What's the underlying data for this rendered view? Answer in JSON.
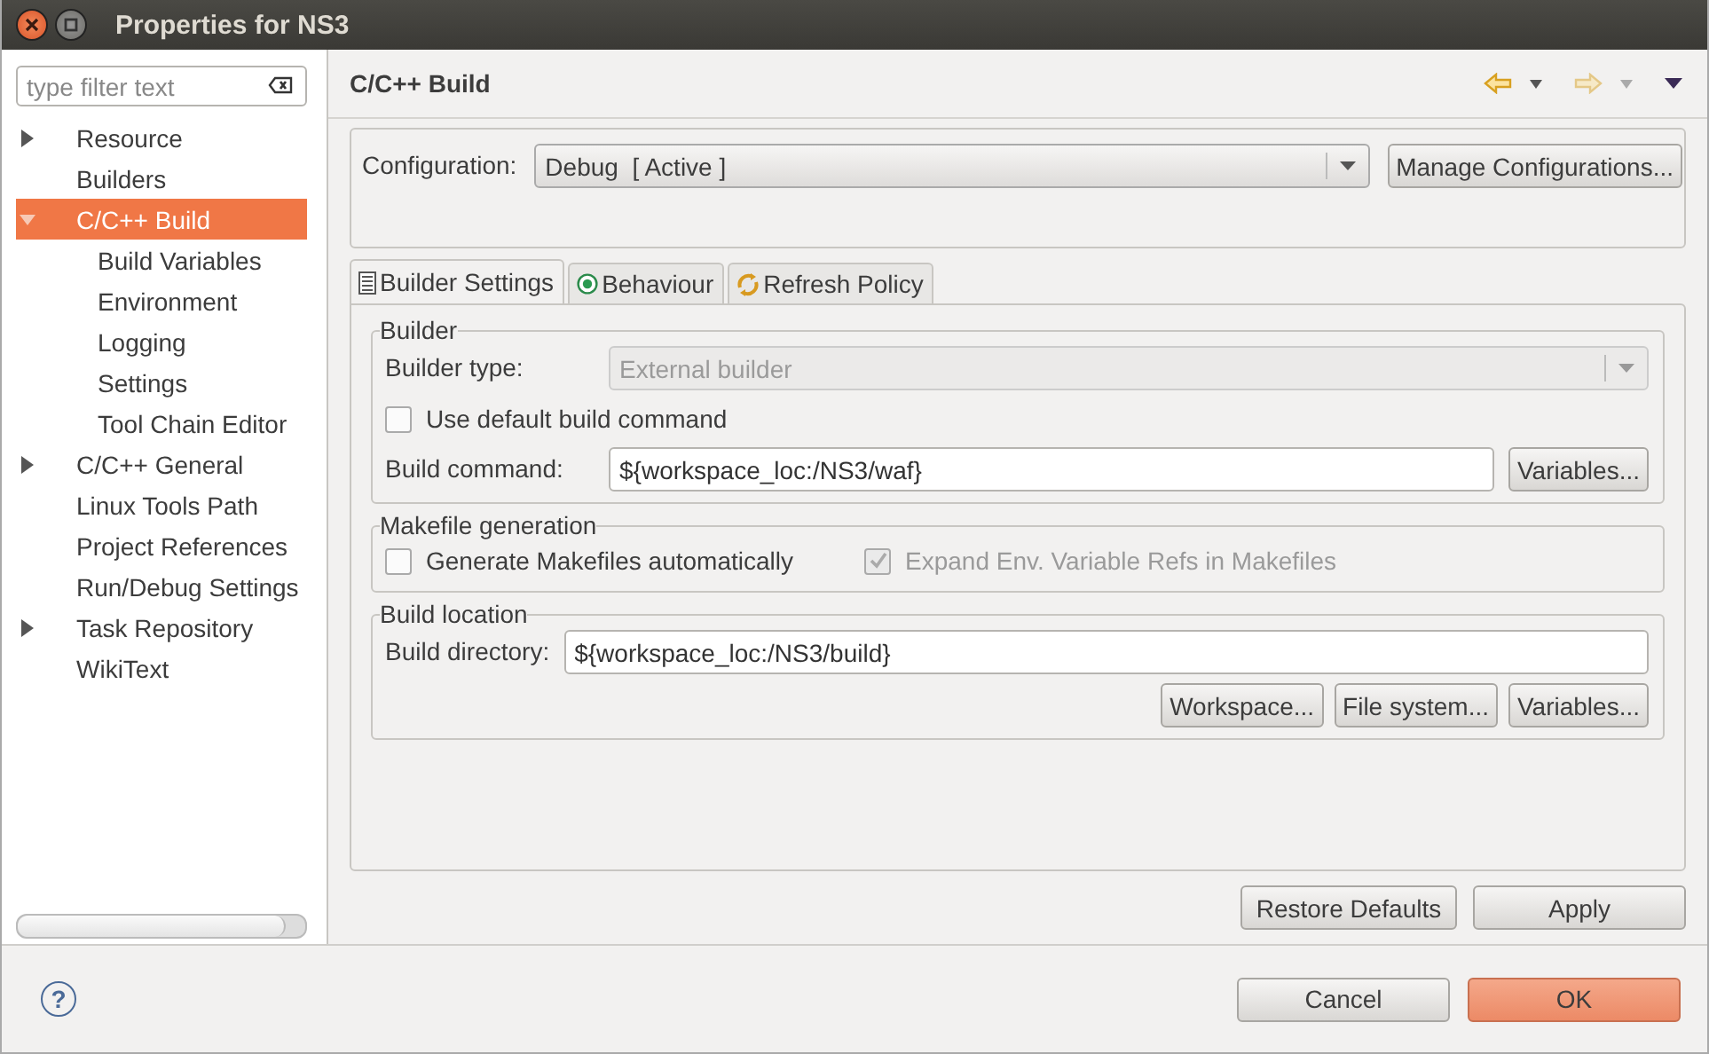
{
  "window": {
    "title": "Properties for NS3"
  },
  "filter": {
    "placeholder": "type filter text"
  },
  "tree": [
    {
      "label": "Resource",
      "expanded": false,
      "selected": false
    },
    {
      "label": "Builders",
      "selected": false
    },
    {
      "label": "C/C++ Build",
      "expanded": true,
      "selected": true,
      "children": [
        {
          "label": "Build Variables",
          "selected": false
        },
        {
          "label": "Environment",
          "selected": false
        },
        {
          "label": "Logging",
          "selected": false
        },
        {
          "label": "Settings",
          "selected": false
        },
        {
          "label": "Tool Chain Editor",
          "selected": false
        }
      ]
    },
    {
      "label": "C/C++ General",
      "expanded": false,
      "selected": false
    },
    {
      "label": "Linux Tools Path",
      "selected": false
    },
    {
      "label": "Project References",
      "selected": false
    },
    {
      "label": "Run/Debug Settings",
      "selected": false
    },
    {
      "label": "Task Repository",
      "expanded": false,
      "selected": false
    },
    {
      "label": "WikiText",
      "selected": false
    }
  ],
  "page": {
    "title": "C/C++ Build",
    "nav": [
      {
        "kind": "back",
        "disabled": false
      },
      {
        "kind": "forward",
        "disabled": true
      }
    ],
    "configuration": {
      "label": "Configuration:",
      "value": "Debug  [ Active ]",
      "button": "Manage Configurations..."
    },
    "tabs": [
      {
        "label": "Builder Settings",
        "selected": true
      },
      {
        "label": "Behaviour",
        "selected": false
      },
      {
        "label": "Refresh Policy",
        "selected": false
      }
    ],
    "builder": {
      "title": "Builder",
      "type_label": "Builder type:",
      "type_value": "External builder",
      "type_disabled": true,
      "checkbox": {
        "label": "Use default build command",
        "checked": false,
        "disabled": false
      },
      "command_label": "Build command:",
      "command_value": "${workspace_loc:/NS3/waf}",
      "button": "Variables..."
    },
    "makefile": {
      "title": "Makefile generation",
      "checkboxes": [
        {
          "label": "Generate Makefiles automatically",
          "checked": false,
          "disabled": false
        },
        {
          "label": "Expand Env. Variable Refs in Makefiles",
          "checked": true,
          "disabled": true
        }
      ]
    },
    "location": {
      "title": "Build location",
      "label": "Build directory:",
      "value": "${workspace_loc:/NS3/build}",
      "buttons": [
        "Workspace...",
        "File system...",
        "Variables..."
      ]
    },
    "buttons": [
      "Restore Defaults",
      "Apply"
    ]
  },
  "footer": {
    "help": "?",
    "buttons": [
      {
        "label": "Cancel",
        "default": false
      },
      {
        "label": "OK",
        "default": true
      }
    ]
  }
}
